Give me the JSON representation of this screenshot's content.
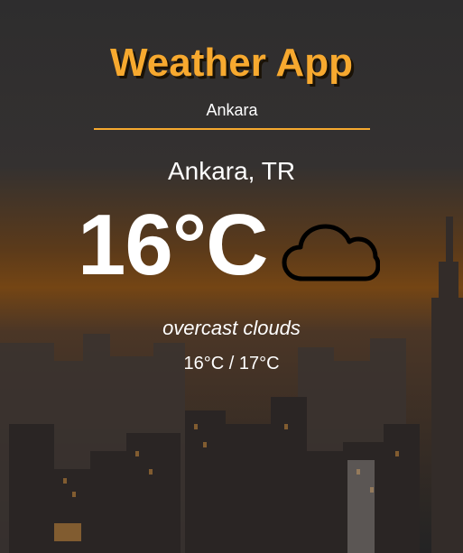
{
  "app": {
    "title": "Weather App"
  },
  "search": {
    "value": "Ankara",
    "placeholder": ""
  },
  "weather": {
    "location": "Ankara, TR",
    "temperature": "16°C",
    "icon": "cloud-icon",
    "description": "overcast clouds",
    "range": "16°C / 17°C"
  },
  "colors": {
    "accent": "#f7a92f",
    "text": "#ffffff"
  }
}
